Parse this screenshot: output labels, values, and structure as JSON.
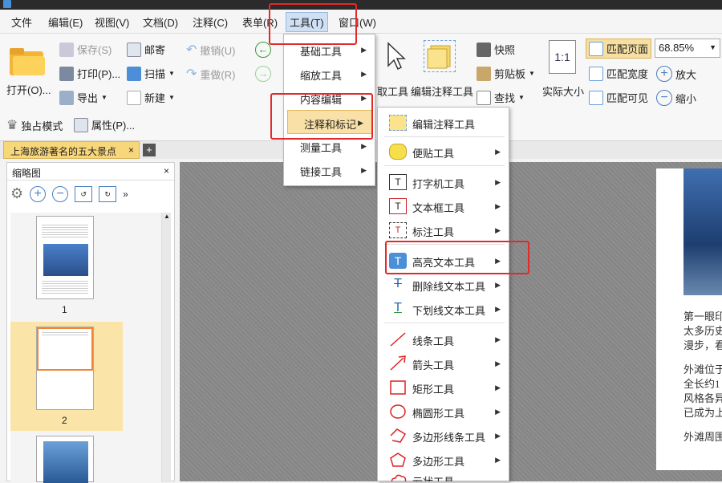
{
  "menubar": {
    "items": [
      "文件",
      "编辑(E)",
      "视图(V)",
      "文档(D)",
      "注释(C)",
      "表单(R)",
      "工具(T)",
      "窗口(W)"
    ]
  },
  "ribbon": {
    "open": "打开(O)...",
    "save": "保存(S)",
    "print": "打印(P)...",
    "export": "导出",
    "mail": "邮寄",
    "scan": "扫描",
    "new": "新建",
    "undo": "撤销(U)",
    "redo": "重做(R)",
    "exclusive": "独占模式",
    "properties": "属性(P)...",
    "tool_select": "取工具",
    "edit_annot_tool": "编辑注释工具",
    "snapshot": "快照",
    "clipboard": "剪贴板",
    "find": "查找",
    "actual_size": "实际大小",
    "actual_size_icon_text": "1:1",
    "fit_page": "匹配页面",
    "fit_width": "匹配宽度",
    "fit_visible": "匹配可见",
    "zoom_value": "68.85%",
    "zoom_in": "放大",
    "zoom_out": "缩小"
  },
  "doc_tab": {
    "title": "上海旅游著名的五大景点"
  },
  "thumbnails": {
    "title": "缩略图",
    "pages": [
      "1",
      "2"
    ]
  },
  "page_text": [
    "第一眼印",
    "太多历史",
    "漫步，看",
    "外滩位于",
    "全长约1",
    "风格各异",
    "已成为上",
    "外滩周围"
  ],
  "menu_tools": {
    "items": [
      "基础工具",
      "缩放工具",
      "内容编辑",
      "注释和标记",
      "测量工具",
      "链接工具"
    ],
    "selected": "注释和标记"
  },
  "menu_annot": {
    "items": [
      "编辑注释工具",
      "便贴工具",
      "打字机工具",
      "文本框工具",
      "标注工具",
      "高亮文本工具",
      "删除线文本工具",
      "下划线文本工具",
      "线条工具",
      "箭头工具",
      "矩形工具",
      "椭圆形工具",
      "多边形线条工具",
      "多边形工具",
      "云状工具"
    ]
  },
  "colors": {
    "highlight_box": "#e12a2a",
    "menu_selected": "#f9e0a6",
    "doc_tab": "#f8d77a"
  }
}
